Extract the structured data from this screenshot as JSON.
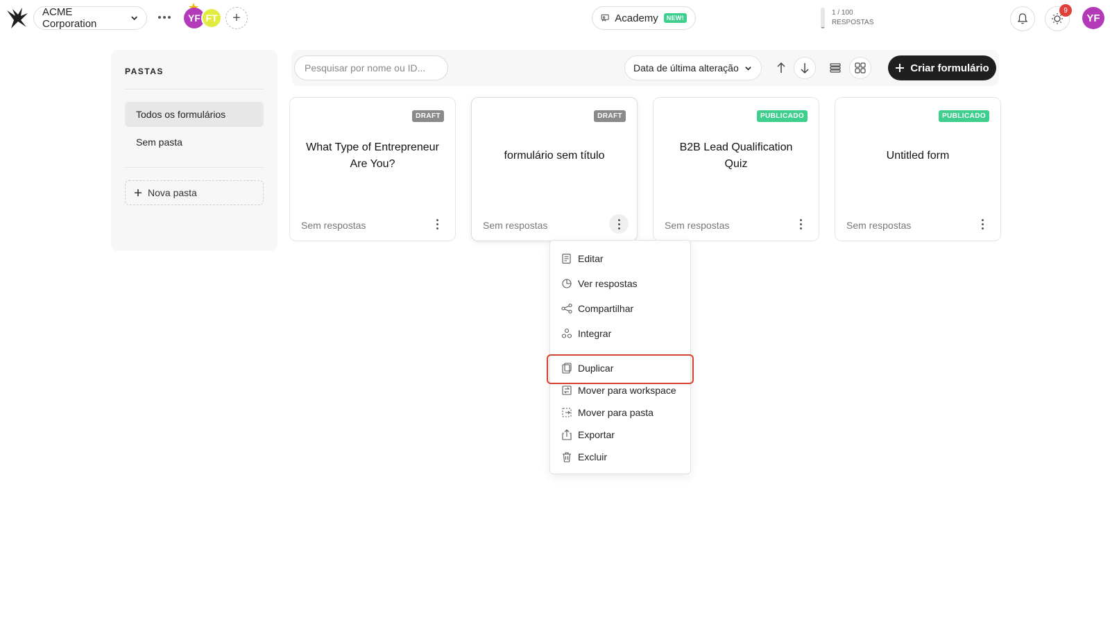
{
  "app": {
    "workspace_name": "ACME Corporation",
    "members": [
      "YF",
      "FT"
    ],
    "academy_label": "Academy",
    "academy_badge": "NEW!",
    "usage_count": "1 / 100",
    "usage_label": "RESPOSTAS",
    "usage_fraction": 0.01,
    "notifications_count": "9",
    "user_initials": "YF",
    "colors": {
      "accent_purple": "#b239b8",
      "accent_yellow": "#e2ec3f",
      "published": "#3ecf8e",
      "draft": "#8a8a8a",
      "highlight": "#d9412f"
    }
  },
  "sidebar": {
    "title": "PASTAS",
    "items": [
      {
        "label": "Todos os formulários",
        "active": true
      },
      {
        "label": "Sem pasta",
        "active": false
      }
    ],
    "new_folder_label": "Nova pasta"
  },
  "toolbar": {
    "search_placeholder": "Pesquisar por nome ou ID...",
    "sort_label": "Data de última alteração",
    "create_label": "Criar formulário"
  },
  "forms": [
    {
      "title": "What Type of Entrepreneur Are You?",
      "status": "DRAFT",
      "responses": "Sem respostas"
    },
    {
      "title": "formulário sem título",
      "status": "DRAFT",
      "responses": "Sem respostas"
    },
    {
      "title": "B2B Lead Qualification Quiz",
      "status": "PUBLICADO",
      "responses": "Sem respostas"
    },
    {
      "title": "Untitled form",
      "status": "PUBLICADO",
      "responses": "Sem respostas"
    }
  ],
  "context_menu": {
    "items": [
      {
        "label": "Editar",
        "icon": "edit-icon"
      },
      {
        "label": "Ver respostas",
        "icon": "responses-icon"
      },
      {
        "label": "Compartilhar",
        "icon": "share-icon"
      },
      {
        "label": "Integrar",
        "icon": "integrate-icon"
      },
      {
        "label": "Duplicar",
        "icon": "duplicate-icon"
      },
      {
        "label": "Mover para workspace",
        "icon": "move-workspace-icon"
      },
      {
        "label": "Mover para pasta",
        "icon": "move-folder-icon"
      },
      {
        "label": "Exportar",
        "icon": "export-icon"
      },
      {
        "label": "Excluir",
        "icon": "trash-icon"
      }
    ]
  }
}
